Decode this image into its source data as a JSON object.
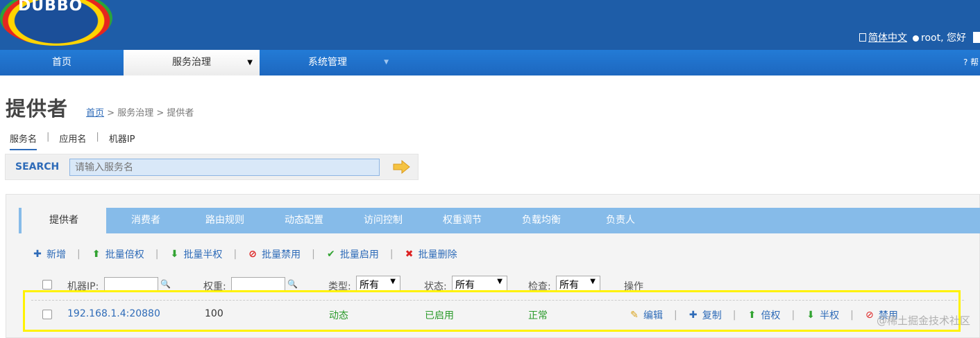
{
  "app": {
    "logo_text": "DUBBO"
  },
  "header": {
    "language": "简体中文",
    "greeting": "root, 您好"
  },
  "nav": {
    "items": [
      "首页",
      "服务治理",
      "系统管理"
    ],
    "help": "? 帮"
  },
  "page": {
    "title": "提供者",
    "breadcrumb": {
      "home": "首页",
      "rest": " > 服务治理 > 提供者"
    }
  },
  "search": {
    "tabs": [
      "服务名",
      "应用名",
      "机器IP"
    ],
    "label": "SEARCH",
    "placeholder": "请输入服务名"
  },
  "tabs": [
    "提供者",
    "消费者",
    "路由规则",
    "动态配置",
    "访问控制",
    "权重调节",
    "负载均衡",
    "负责人"
  ],
  "toolbar": [
    "新增",
    "批量倍权",
    "批量半权",
    "批量禁用",
    "批量启用",
    "批量删除"
  ],
  "filters": {
    "ip_label": "机器IP:",
    "weight_label": "权重:",
    "type_label": "类型:",
    "type_value": "所有",
    "status_label": "状态:",
    "status_value": "所有",
    "check_label": "检查:",
    "check_value": "所有",
    "ops_label": "操作"
  },
  "row": {
    "address": "192.168.1.4:20880",
    "weight": "100",
    "type": "动态",
    "status": "已启用",
    "check": "正常",
    "ops": [
      "编辑",
      "复制",
      "倍权",
      "半权",
      "禁用"
    ]
  },
  "watermark": "@稀土掘金技术社区",
  "colors": {
    "header": "#1e5da8",
    "nav": "#1d67bf",
    "tabs": "#86bbe9",
    "link": "#2e6bb8",
    "green": "#2a9a2a",
    "highlight": "#fff200"
  }
}
